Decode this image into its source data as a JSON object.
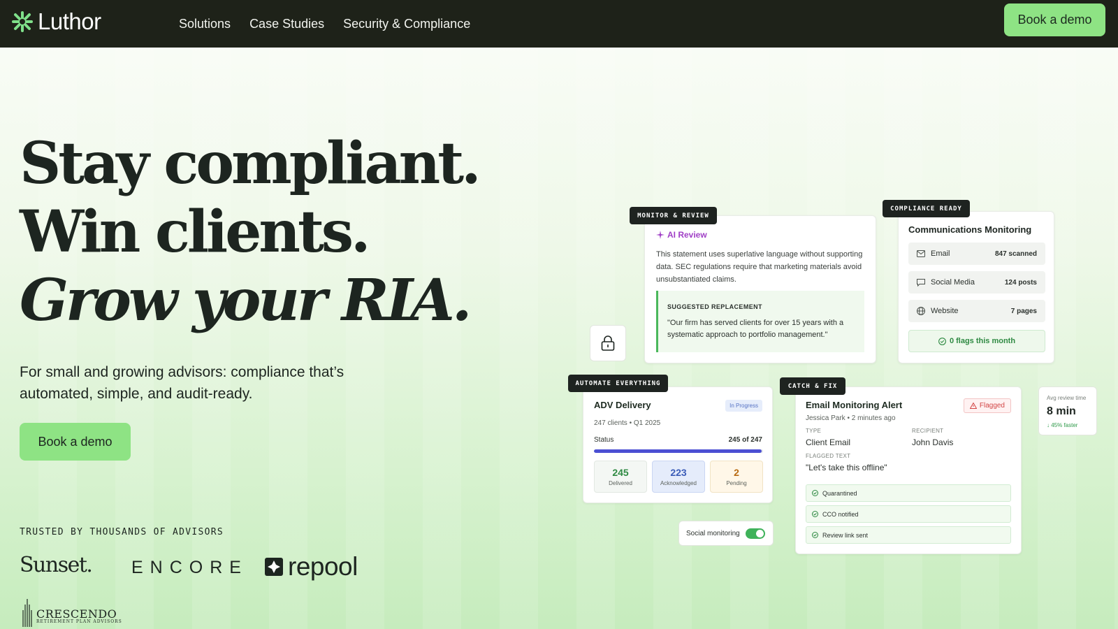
{
  "nav": {
    "brand": "Luthor",
    "links": [
      "Solutions",
      "Case Studies",
      "Security & Compliance"
    ],
    "cta": "Book a demo"
  },
  "hero": {
    "line1": "Stay compliant.",
    "line2": "Win clients.",
    "line3": "Grow your RIA.",
    "subtitle": "For small and growing advisors: compliance that’s automated, simple, and audit-ready.",
    "cta": "Book a demo"
  },
  "trusted": {
    "heading": "TRUSTED BY THOUSANDS OF ADVISORS",
    "brands": {
      "sunset": "Sunset.",
      "encore": "ENCORE",
      "repool": "repool",
      "crescendo": "CRESCENDO",
      "crescendo_sub": "RETIREMENT PLAN ADVISORS"
    }
  },
  "tags": {
    "monitor": "MONITOR & REVIEW",
    "compliance": "COMPLIANCE READY",
    "automate": "AUTOMATE EVERYTHING",
    "catch": "CATCH & FIX"
  },
  "ai_review": {
    "title": "AI Review",
    "text": "This statement uses superlative language without supporting data. SEC regulations require that marketing materials avoid unsubstantiated claims.",
    "suggest_label": "SUGGESTED REPLACEMENT",
    "suggest_text": "\"Our firm has served clients for over 15 years with a systematic approach to portfolio management.\""
  },
  "comms": {
    "title": "Communications Monitoring",
    "rows": [
      {
        "label": "Email",
        "value": "847 scanned",
        "icon": "mail-icon"
      },
      {
        "label": "Social Media",
        "value": "124 posts",
        "icon": "chat-icon"
      },
      {
        "label": "Website",
        "value": "7 pages",
        "icon": "globe-icon"
      }
    ],
    "flags": "0 flags this month"
  },
  "adv": {
    "title": "ADV Delivery",
    "badge": "In Progress",
    "meta": "247 clients • Q1 2025",
    "status_label": "Status",
    "status_count": "245 of 247",
    "progress": 0.992,
    "stats": [
      {
        "num": "245",
        "label": "Delivered"
      },
      {
        "num": "223",
        "label": "Acknowledged"
      },
      {
        "num": "2",
        "label": "Pending"
      }
    ]
  },
  "toggle": {
    "label": "Social monitoring",
    "on": true
  },
  "email": {
    "title": "Email Monitoring Alert",
    "flag": "Flagged",
    "meta": "Jessica Park • 2 minutes ago",
    "type_label": "TYPE",
    "type_value": "Client Email",
    "recipient_label": "RECIPIENT",
    "recipient_value": "John Davis",
    "flagged_label": "FLAGGED TEXT",
    "flagged_value": "\"Let's take this offline\"",
    "checks": [
      "Quarantined",
      "CCO notified",
      "Review link sent"
    ]
  },
  "avg": {
    "label": "Avg review time",
    "value": "8 min",
    "delta": "↓ 45% faster"
  },
  "colors": {
    "nav_bg": "#1e2219",
    "accent_green": "#8ee384",
    "ai_purple": "#a03fc6",
    "progress_blue": "#4b4fd3"
  }
}
